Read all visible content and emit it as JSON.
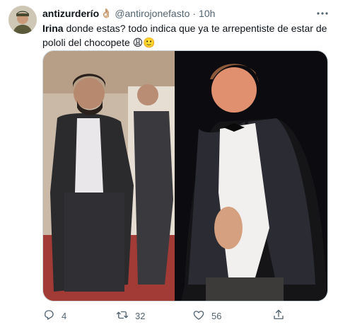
{
  "tweet": {
    "author_name": "antizurderío",
    "author_emoji": "👌🏼",
    "handle": "@antirojonefasto",
    "separator": "·",
    "time": "10h",
    "mention": "Irina",
    "text": " donde estas? todo indica que ya te arrepentiste de estar de pololi del chocopete 😩🙂"
  },
  "actions": {
    "reply_count": "4",
    "retweet_count": "32",
    "like_count": "56"
  },
  "icons": {
    "more": "more-icon",
    "reply": "reply-icon",
    "retweet": "retweet-icon",
    "like": "like-icon",
    "share": "share-icon"
  },
  "colors": {
    "text": "#0f1419",
    "secondary": "#536471",
    "border": "#cfd9de"
  }
}
